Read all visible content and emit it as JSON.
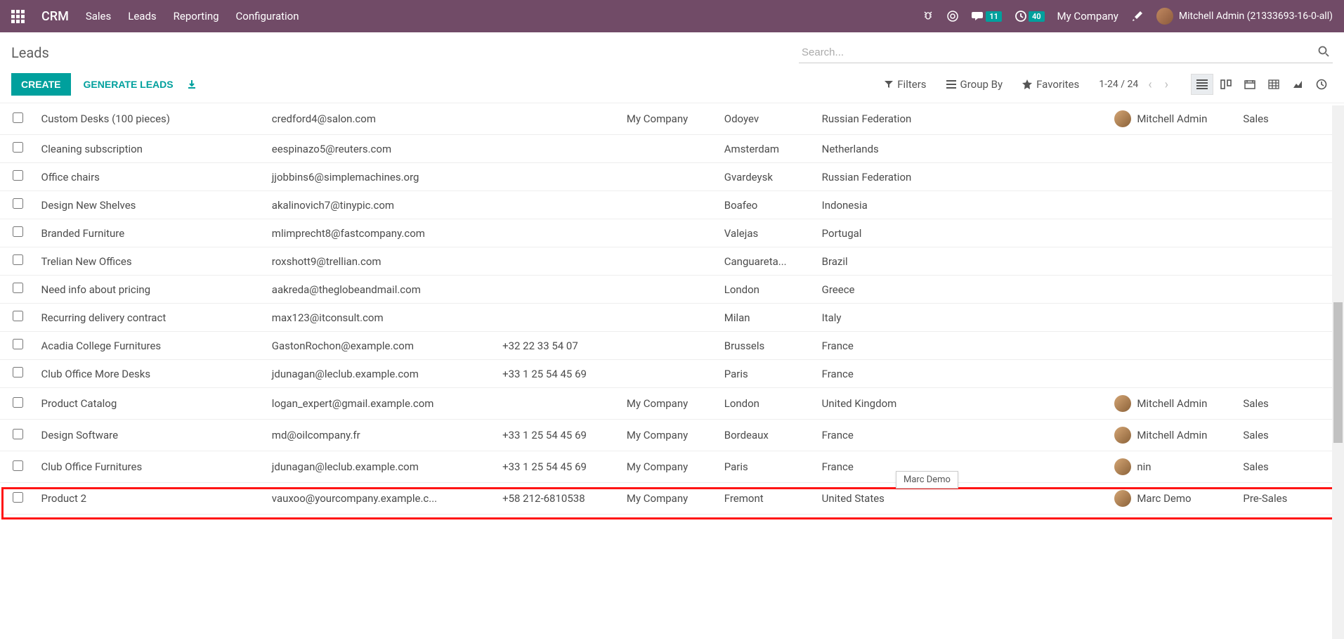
{
  "topbar": {
    "brand": "CRM",
    "nav": [
      "Sales",
      "Leads",
      "Reporting",
      "Configuration"
    ],
    "messages_badge": "11",
    "activities_badge": "40",
    "company": "My Company",
    "user": "Mitchell Admin (21333693-16-0-all)"
  },
  "control": {
    "title": "Leads",
    "search_placeholder": "Search...",
    "create": "CREATE",
    "generate": "GENERATE LEADS",
    "filters": "Filters",
    "groupby": "Group By",
    "favorites": "Favorites",
    "pager": "1-24 / 24"
  },
  "tooltip": "Marc Demo",
  "rows": [
    {
      "lead": "Custom Desks (100 pieces)",
      "email": "credford4@salon.com",
      "phone": "",
      "company": "My Company",
      "city": "Odoyev",
      "country": "Russian Federation",
      "sp": "Mitchell Admin",
      "team": "Sales",
      "avatar": true
    },
    {
      "lead": "Cleaning subscription",
      "email": "eespinazo5@reuters.com",
      "phone": "",
      "company": "",
      "city": "Amsterdam",
      "country": "Netherlands",
      "sp": "",
      "team": "",
      "avatar": false
    },
    {
      "lead": "Office chairs",
      "email": "jjobbins6@simplemachines.org",
      "phone": "",
      "company": "",
      "city": "Gvardeysk",
      "country": "Russian Federation",
      "sp": "",
      "team": "",
      "avatar": false
    },
    {
      "lead": "Design New Shelves",
      "email": "akalinovich7@tinypic.com",
      "phone": "",
      "company": "",
      "city": "Boafeo",
      "country": "Indonesia",
      "sp": "",
      "team": "",
      "avatar": false
    },
    {
      "lead": "Branded Furniture",
      "email": "mlimprecht8@fastcompany.com",
      "phone": "",
      "company": "",
      "city": "Valejas",
      "country": "Portugal",
      "sp": "",
      "team": "",
      "avatar": false
    },
    {
      "lead": "Trelian New Offices",
      "email": "roxshott9@trellian.com",
      "phone": "",
      "company": "",
      "city": "Canguareta...",
      "country": "Brazil",
      "sp": "",
      "team": "",
      "avatar": false
    },
    {
      "lead": "Need info about pricing",
      "email": "aakreda@theglobeandmail.com",
      "phone": "",
      "company": "",
      "city": "London",
      "country": "Greece",
      "sp": "",
      "team": "",
      "avatar": false
    },
    {
      "lead": "Recurring delivery contract",
      "email": "max123@itconsult.com",
      "phone": "",
      "company": "",
      "city": "Milan",
      "country": "Italy",
      "sp": "",
      "team": "",
      "avatar": false
    },
    {
      "lead": "Acadia College Furnitures",
      "email": "GastonRochon@example.com",
      "phone": "+32 22 33 54 07",
      "company": "",
      "city": "Brussels",
      "country": "France",
      "sp": "",
      "team": "",
      "avatar": false
    },
    {
      "lead": "Club Office More Desks",
      "email": "jdunagan@leclub.example.com",
      "phone": "+33 1 25 54 45 69",
      "company": "",
      "city": "Paris",
      "country": "France",
      "sp": "",
      "team": "",
      "avatar": false
    },
    {
      "lead": "Product Catalog",
      "email": "logan_expert@gmail.example.com",
      "phone": "",
      "company": "My Company",
      "city": "London",
      "country": "United Kingdom",
      "sp": "Mitchell Admin",
      "team": "Sales",
      "avatar": true
    },
    {
      "lead": "Design Software",
      "email": "md@oilcompany.fr",
      "phone": "+33 1 25 54 45 69",
      "company": "My Company",
      "city": "Bordeaux",
      "country": "France",
      "sp": "Mitchell Admin",
      "team": "Sales",
      "avatar": true
    },
    {
      "lead": "Club Office Furnitures",
      "email": "jdunagan@leclub.example.com",
      "phone": "+33 1 25 54 45 69",
      "company": "My Company",
      "city": "Paris",
      "country": "France",
      "sp": "nin",
      "team": "Sales",
      "avatar": true
    },
    {
      "lead": "Product 2",
      "email": "vauxoo@yourcompany.example.c...",
      "phone": "+58 212-6810538",
      "company": "My Company",
      "city": "Fremont",
      "country": "United States",
      "sp": "Marc Demo",
      "team": "Pre-Sales",
      "avatar": true
    }
  ]
}
